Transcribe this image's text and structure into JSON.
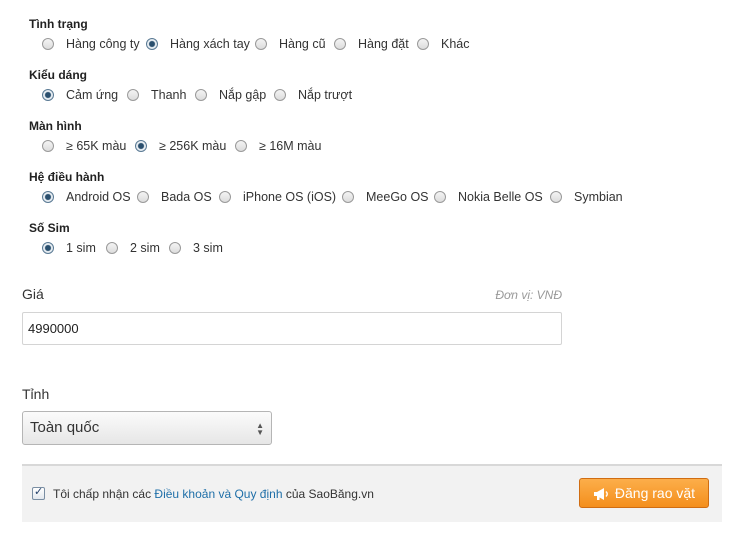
{
  "filters": [
    {
      "title": "Tình trạng",
      "options": [
        {
          "label": "Hàng công ty",
          "selected": false
        },
        {
          "label": "Hàng xách tay",
          "selected": true
        },
        {
          "label": "Hàng cũ",
          "selected": false
        },
        {
          "label": "Hàng đặt",
          "selected": false
        },
        {
          "label": "Khác",
          "selected": false
        }
      ]
    },
    {
      "title": "Kiểu dáng",
      "options": [
        {
          "label": "Cảm ứng",
          "selected": true
        },
        {
          "label": "Thanh",
          "selected": false
        },
        {
          "label": "Nắp gập",
          "selected": false
        },
        {
          "label": "Nắp trượt",
          "selected": false
        }
      ]
    },
    {
      "title": "Màn hình",
      "options": [
        {
          "label": "≥ 65K màu",
          "selected": false
        },
        {
          "label": "≥ 256K màu",
          "selected": true
        },
        {
          "label": "≥ 16M màu",
          "selected": false
        }
      ]
    },
    {
      "title": "Hệ điều hành",
      "options": [
        {
          "label": "Android OS",
          "selected": true
        },
        {
          "label": "Bada OS",
          "selected": false
        },
        {
          "label": "iPhone OS (iOS)",
          "selected": false
        },
        {
          "label": "MeeGo OS",
          "selected": false
        },
        {
          "label": "Nokia Belle OS",
          "selected": false
        },
        {
          "label": "Symbian",
          "selected": false
        }
      ]
    },
    {
      "title": "Số Sim",
      "options": [
        {
          "label": "1 sim",
          "selected": true
        },
        {
          "label": "2 sim",
          "selected": false
        },
        {
          "label": "3 sim",
          "selected": false
        }
      ]
    }
  ],
  "price": {
    "label": "Giá",
    "unit_hint": "Đơn vị: VNĐ",
    "value": "4990000"
  },
  "province": {
    "label": "Tỉnh",
    "selected": "Toàn quốc"
  },
  "agreement": {
    "checked": true,
    "prefix": "Tôi chấp nhận các",
    "link_text": "Điều khoản và Quy định",
    "suffix": "của SaoBăng.vn"
  },
  "submit": {
    "label": "Đăng rao vặt",
    "icon": "megaphone-icon"
  },
  "colors": {
    "button": "#f7971f",
    "link": "#1f6fa8",
    "footer_bg": "#f2f2f2"
  }
}
